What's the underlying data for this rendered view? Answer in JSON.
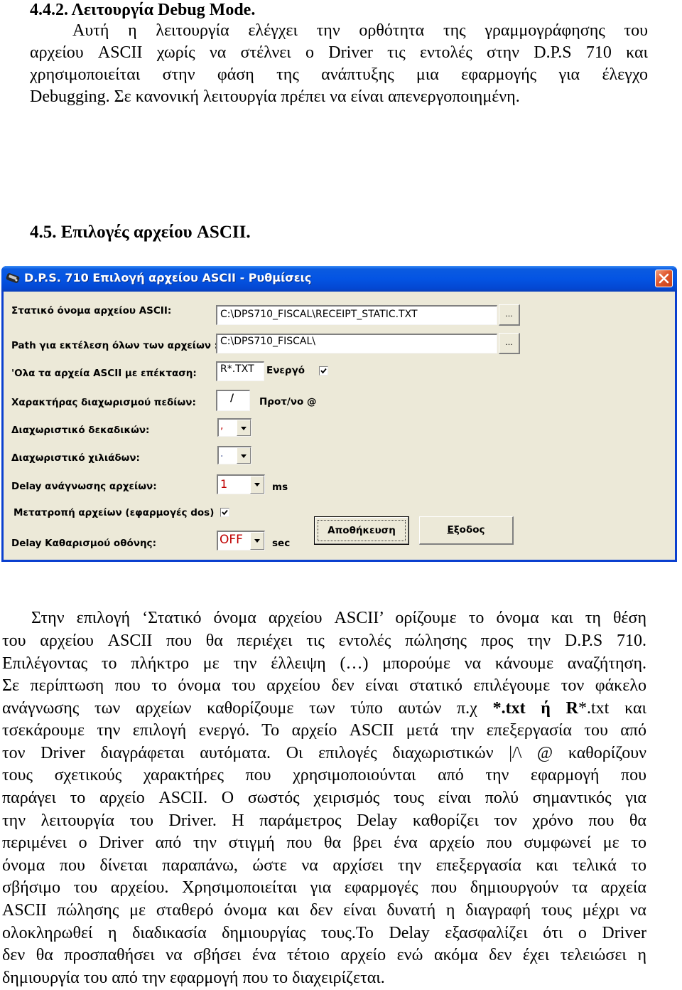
{
  "section_442": {
    "heading": "4.4.2.  Λειτουργία Debug Mode.",
    "lines": [
      "Αυτή η λειτουργία ελέγχει την ορθότητα της γραμμογράφησης του",
      "αρχείου ASCII χωρίς να στέλνει ο Driver τις εντολές στην D.P.S 710   και",
      "χρησιμοποιείται στην φάση της ανάπτυξης μια εφαρμογής για έλεγχο",
      "Debugging. Σε κανονική λειτουργία πρέπει να είναι απενεργοποιημένη."
    ]
  },
  "section_45": {
    "heading": "4.5. Επιλογές αρχείου ASCII."
  },
  "dialog": {
    "title": "D.P.S. 710  Επιλογή αρχείου ASCII - Ρυθμίσεις",
    "icon": "app-printer-icon",
    "close_icon": "close-icon",
    "static_filename": {
      "label": "Στατικό όνομα αρχείου ASCII:",
      "value": "C:\\DPS710_FISCAL\\RECEIPT_STATIC.TXT",
      "browse_label": "..."
    },
    "exec_path": {
      "label": "Path για εκτέλεση όλων των αρχείων :",
      "value": "C:\\DPS710_FISCAL\\",
      "browse_label": "..."
    },
    "extension": {
      "label": "'Ολα τα αρχεία ASCII με επέκταση:",
      "value": "R*.TXT",
      "active_label": "Ενεργό",
      "active_checked": true
    },
    "field_separator": {
      "label": "Χαρακτήρας διαχωρισμού πεδίων:",
      "value": "/",
      "default_label": "Προτ/νο @"
    },
    "decimal_separator": {
      "label": "Διαχωριστικό δεκαδικών:",
      "value": ","
    },
    "thousands_separator": {
      "label": "Διαχωριστικό χιλιάδων:",
      "value": "."
    },
    "read_delay": {
      "label": "Delay ανάγνωσης αρχείων:",
      "value": "1",
      "unit": "ms"
    },
    "convert_files": {
      "label": "Μετατροπή αρχείων (εφαρμογές dos)",
      "checked": true
    },
    "screen_clear_delay": {
      "label": "Delay Καθαρισμού οθόνης:",
      "value": "OFF",
      "unit": "sec"
    },
    "save_button": "Αποθήκευση",
    "exit_button_mnemonic": "Ε",
    "exit_button_rest": "ξοδος"
  },
  "section_45_text": {
    "lines": [
      "Στην επιλογή ‘Στατικό όνομα αρχείου ASCII’ ορίζουμε το όνομα και τη θέση",
      "του αρχείου ASCII που θα περιέχει τις εντολές πώλησης προς την D.P.S 710.",
      "Επιλέγοντας το πλήκτρο με την έλλειψη (…) μπορούμε να κάνουμε αναζήτηση.",
      "Σε περίπτωση που το όνομα του αρχείου δεν είναι στατικό επιλέγουμε τον φάκελο",
      "τσεκάρουμε την επιλογή ενεργό. Το αρχείο ASCII μετά την επεξεργασία του από",
      "τον Driver διαγράφεται αυτόματα. Οι επιλογές διαχωριστικών  |/\\  @ καθορίζουν",
      "τους σχετικούς χαρακτήρες που  χρησιμοποιούνται από την εφαρμογή που",
      "παράγει το αρχείο ASCII. Ο σωστός χειρισμός τους είναι πολύ σημαντικός για",
      "την λειτουργία του Driver. Η παράμετρος Delay καθορίζει τον χρόνο που θα",
      "περιμένει ο Driver από την στιγμή που θα βρει ένα αρχείο που συμφωνεί με το",
      "όνομα που δίνεται παραπάνω, ώστε να αρχίσει την επεξεργασία και τελικά το",
      "σβήσιμο του αρχείου. Χρησιμοποιείται για εφαρμογές που δημιουργούν τα αρχεία",
      "ASCII πώλησης με σταθερό όνομα και δεν είναι δυνατή η διαγραφή τους μέχρι να",
      "ολοκληρωθεί η διαδικασία δημιουργίας τους.Το Delay εξασφαλίζει ότι ο Driver",
      "δεν θα προσπαθήσει να σβήσει ένα τέτοιο αρχείο ενώ ακόμα δεν έχει τελειώσει η",
      "δημιουργία του από την εφαρμογή που το διαχειρίζεται."
    ],
    "line5": {
      "start": "ανάγνωσης των αρχείων καθορίζουμε των τύπο αυτών π.χ ",
      "bold1": "*.txt ή R",
      "end": "*.txt και"
    }
  }
}
